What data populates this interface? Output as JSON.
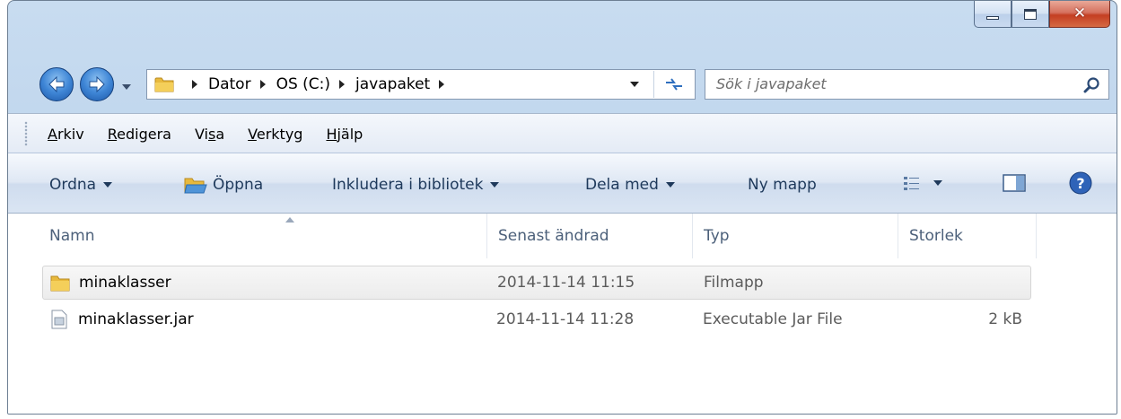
{
  "window": {
    "controls": {
      "minimize": "minimize",
      "maximize": "maximize",
      "close": "close"
    }
  },
  "navigation": {
    "breadcrumbs": [
      "Dator",
      "OS (C:)",
      "javapaket"
    ],
    "search_placeholder": "Sök i javapaket"
  },
  "menubar": {
    "items": [
      {
        "pre": "",
        "u": "A",
        "post": "rkiv"
      },
      {
        "pre": "",
        "u": "R",
        "post": "edigera"
      },
      {
        "pre": "Vi",
        "u": "s",
        "post": "a"
      },
      {
        "pre": "",
        "u": "V",
        "post": "erktyg"
      },
      {
        "pre": "",
        "u": "H",
        "post": "jälp"
      }
    ]
  },
  "commandbar": {
    "organize": "Ordna",
    "open": "Öppna",
    "include_in_library": "Inkludera i bibliotek",
    "share_with": "Dela med",
    "new_folder": "Ny mapp"
  },
  "columns": {
    "name": "Namn",
    "modified": "Senast ändrad",
    "type": "Typ",
    "size": "Storlek"
  },
  "files": [
    {
      "name": "minaklasser",
      "modified": "2014-11-14 11:15",
      "type": "Filmapp",
      "size": "",
      "icon": "folder-icon"
    },
    {
      "name": "minaklasser.jar",
      "modified": "2014-11-14 11:28",
      "type": "Executable Jar File",
      "size": "2 kB",
      "icon": "jar-file-icon"
    }
  ],
  "colors": {
    "frame": "#bcd3ec",
    "accent": "#3f86d6",
    "close": "#c43e22",
    "header_text": "#4c607a",
    "command_text": "#1e395b"
  }
}
